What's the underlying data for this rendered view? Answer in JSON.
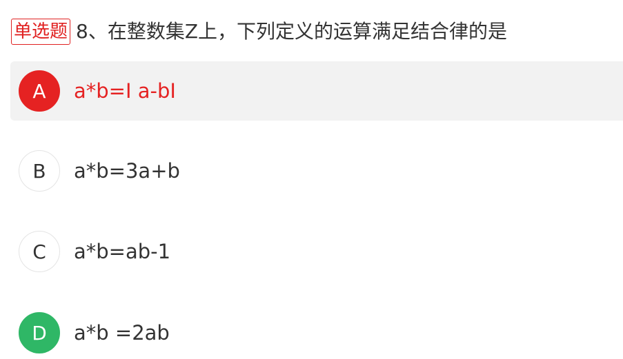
{
  "question": {
    "type_label": "单选题",
    "text": "8、在整数集Z上，下列定义的运算满足结合律的是"
  },
  "colors": {
    "wrong": "#e52222",
    "correct": "#2fb766",
    "selected_bg": "#f2f2f2",
    "text": "#333333"
  },
  "options": [
    {
      "letter": "A",
      "text": "a*b=I a-bI",
      "state": "selected-wrong"
    },
    {
      "letter": "B",
      "text": "a*b=3a+b",
      "state": "normal"
    },
    {
      "letter": "C",
      "text": "a*b=ab-1",
      "state": "normal"
    },
    {
      "letter": "D",
      "text": "a*b =2ab",
      "state": "correct"
    }
  ]
}
